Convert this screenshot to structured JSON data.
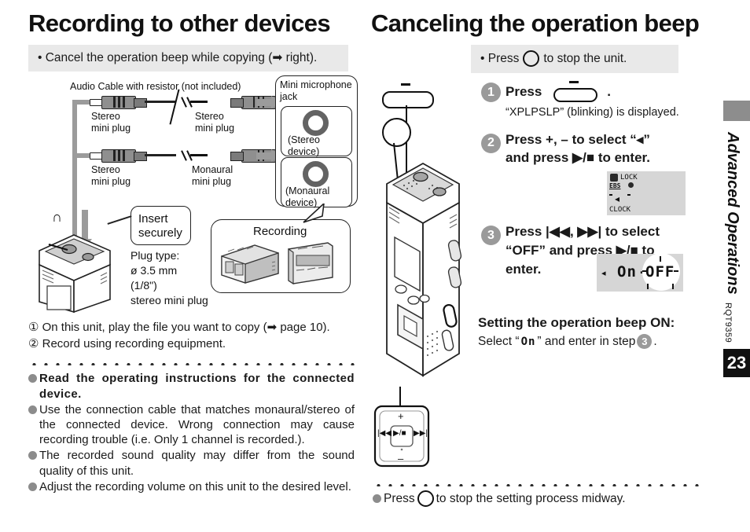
{
  "left": {
    "heading": "Recording to other devices",
    "note_band": "• Cancel the operation beep while copying (➡ right).",
    "diagram": {
      "cable_label": "Audio Cable with resistor (not included)",
      "plug_left_top": "Stereo\nmini plug",
      "plug_right_top": "Stereo\nmini plug",
      "plug_left_bottom": "Stereo\nmini plug",
      "plug_right_bottom": "Monaural\nmini plug",
      "jack_title": "Mini microphone\njack",
      "jack_stereo": "(Stereo\ndevice)",
      "jack_monaural": "(Monaural\ndevice)",
      "insert_callout": "Insert\nsecurely",
      "plug_type_1": "Plug type:",
      "plug_type_2": "ø 3.5 mm",
      "plug_type_3": "(1/8\")",
      "plug_type_4": "stereo mini plug",
      "recording_box": "Recording",
      "headphone_icon": "headphone-jack-icon"
    },
    "steps": [
      "① On this unit, play the file you want to copy (➡ page 10).",
      "② Record using recording equipment."
    ],
    "bullets": [
      {
        "bold": true,
        "text": "Read the operating instructions for the connected device."
      },
      {
        "bold": false,
        "text": "Use the connection cable that matches monaural/stereo of the connected device. Wrong connection may cause recording trouble (i.e. Only 1 channel is recorded.)."
      },
      {
        "bold": false,
        "text": "The recorded sound quality may differ from the sound quality of this unit."
      },
      {
        "bold": false,
        "text": "Adjust the recording volume on this unit to the desired level."
      }
    ]
  },
  "right": {
    "heading": "Canceling the operation beep",
    "note_band_pre": "• Press",
    "note_band_post": "to stop the unit.",
    "step1": {
      "num": "1",
      "line1_pre": "Press",
      "line1_post": ".",
      "line2": "“XPLPSLP” (blinking) is displayed."
    },
    "step2": {
      "num": "2",
      "line1": "Press +, – to select “◂”",
      "line2": "and press ▶/■ to enter.",
      "lcd": {
        "lock": "LOCK",
        "ebs": "EBS",
        "clock": "CLOCK",
        "beep_icon": "beep-speaker-icon"
      }
    },
    "step3": {
      "num": "3",
      "line1": "Press |◀◀, ▶▶| to select",
      "line2": "“OFF” and press ▶/■ to",
      "line3": "enter.",
      "lcd": {
        "on": "On",
        "off": "OFF",
        "sep": "-"
      }
    },
    "setting_on": {
      "title": "Setting the operation beep ON:",
      "pre": "Select “",
      "value": "On",
      "mid": "” and enter in step",
      "step": "3",
      "post": "."
    },
    "footer_bullet_pre": "Press",
    "footer_bullet_post": "to stop the setting process midway.",
    "device_labels": {
      "pad_plus": "+",
      "pad_minus": "–",
      "pad_prev": "|◀◀",
      "pad_next": "▶▶|",
      "pad_center": "▶/■"
    }
  },
  "sidebar": {
    "section_title": "Advanced Operations",
    "doc_code": "RQT9359",
    "page_number": "23"
  },
  "colors": {
    "band_gray": "#e9e9e9",
    "bullet_gray": "#8c8c8c",
    "step_circle_gray": "#9a9a9a",
    "tab_gray": "#8d8d8d",
    "lcd_gray": "#d6d6d6",
    "page_black": "#111111"
  }
}
